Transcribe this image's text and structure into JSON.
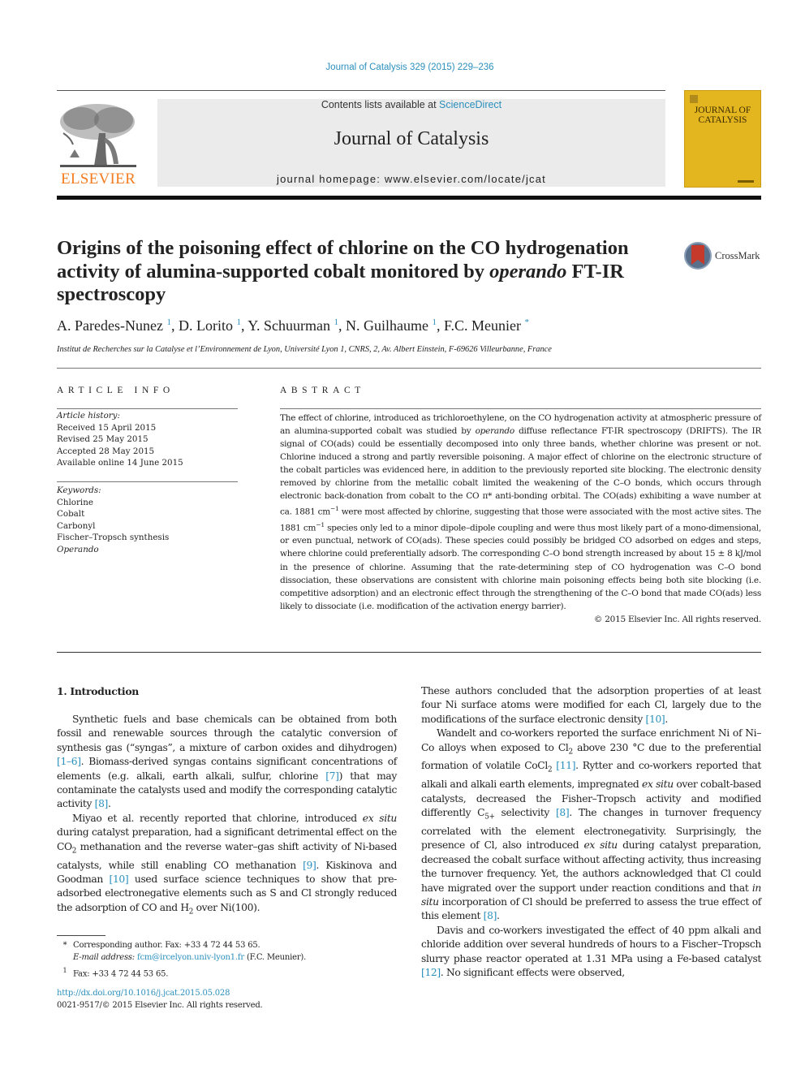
{
  "running_head": "Journal of Catalysis 329 (2015) 229–236",
  "masthead": {
    "publisher": "ELSEVIER",
    "contents_prefix": "Contents lists available at ",
    "contents_link": "ScienceDirect",
    "journal_title": "Journal of Catalysis",
    "homepage_prefix": "journal homepage: ",
    "homepage_url": "www.elsevier.com/locate/jcat",
    "cover_title_line1": "JOURNAL OF",
    "cover_title_line2": "CATALYSIS"
  },
  "colors": {
    "link": "#2a8fbd",
    "publisher_orange": "#f47c20",
    "cover_yellow": "#e3b51f",
    "masthead_gray": "#ebebeb"
  },
  "article": {
    "title_part1": "Origins of the poisoning effect of chlorine on the CO hydrogenation activity of alumina-supported cobalt monitored by ",
    "title_italic": "operando",
    "title_part2": " FT-IR spectroscopy",
    "crossmark_label": "CrossMark",
    "authors": [
      {
        "name": "A. Paredes-Nunez",
        "mark": "1"
      },
      {
        "name": "D. Lorito",
        "mark": "1"
      },
      {
        "name": "Y. Schuurman",
        "mark": "1"
      },
      {
        "name": "N. Guilhaume",
        "mark": "1"
      },
      {
        "name": "F.C. Meunier",
        "mark": "*"
      }
    ],
    "affiliation": "Institut de Recherches sur la Catalyse et l’Environnement de Lyon, Université Lyon 1, CNRS, 2, Av. Albert Einstein, F-69626 Villeurbanne, France"
  },
  "article_info": {
    "heading": "ARTICLE INFO",
    "history_label": "Article history:",
    "history": [
      "Received 15 April 2015",
      "Revised 25 May 2015",
      "Accepted 28 May 2015",
      "Available online 14 June 2015"
    ],
    "keywords_label": "Keywords:",
    "keywords": [
      "Chlorine",
      "Cobalt",
      "Carbonyl",
      "Fischer–Tropsch synthesis"
    ],
    "keyword_italic": "Operando"
  },
  "abstract": {
    "heading": "ABSTRACT",
    "s1": "The effect of chlorine, introduced as trichloroethylene, on the CO hydrogenation activity at atmospheric pressure of an alumina-supported cobalt was studied by ",
    "s1_it": "operando",
    "s2": " diffuse reflectance FT-IR spectroscopy (DRIFTS). The IR signal of CO(ads) could be essentially decomposed into only three bands, whether chlorine was present or not. Chlorine induced a strong and partly reversible poisoning. A major effect of chlorine on the electronic structure of the cobalt particles was evidenced here, in addition to the previously reported site blocking. The electronic density removed by chlorine from the metallic cobalt limited the weakening of the C–O bonds, which occurs through electronic back-donation from cobalt to the CO π* anti-bonding orbital. The CO(ads) exhibiting a wave number at ca. 1881 cm",
    "s3": " were most affected by chlorine, suggesting that those were associated with the most active sites. The 1881 cm",
    "s4": " species only led to a minor dipole–dipole coupling and were thus most likely part of a mono-dimensional, or even punctual, network of CO(ads). These species could possibly be bridged CO adsorbed on edges and steps, where chlorine could preferentially adsorb. The corresponding C–O bond strength increased by about 15 ± 8 kJ/mol in the presence of chlorine. Assuming that the rate-determining step of CO hydrogenation was C–O bond dissociation, these observations are consistent with chlorine main poisoning effects being both site blocking (i.e. competitive adsorption) and an electronic effect through the strengthening of the C–O bond that made CO(ads) less likely to dissociate (i.e. modification of the activation energy barrier).",
    "exp": "−1",
    "copyright": "© 2015 Elsevier Inc. All rights reserved."
  },
  "intro": {
    "heading": "1. Introduction",
    "p1a": "Synthetic fuels and base chemicals can be obtained from both fossil and renewable sources through the catalytic conversion of synthesis gas (“syngas”, a mixture of carbon oxides and dihydrogen) ",
    "p1_ref1": "[1–6]",
    "p1b": ". Biomass-derived syngas contains significant concentrations of elements (e.g. alkali, earth alkali, sulfur, chlorine ",
    "p1_ref2": "[7]",
    "p1c": ") that may contaminate the catalysts used and modify the corresponding catalytic activity ",
    "p1_ref3": "[8]",
    "p2a": "Miyao et al. recently reported that chlorine, introduced ",
    "p2_it": "ex situ",
    "p2b": " during catalyst preparation, had a significant detrimental effect on the CO",
    "p2c": " methanation and the reverse water–gas shift activity of Ni-based catalysts, while still enabling CO methanation ",
    "p2_ref1": "[9]",
    "p2d": ". Kiskinova and Goodman ",
    "p2_ref2": "[10]",
    "p2e": " used surface science techniques to show that pre-adsorbed electronegative elements such as S and Cl strongly reduced the adsorption of CO and H",
    "p2f": " over Ni(100).",
    "sub2": "2"
  },
  "right_col": {
    "p1a": "These authors concluded that the adsorption properties of at least four Ni surface atoms were modified for each Cl, largely due to the modifications of the surface electronic density ",
    "p1_ref": "[10]",
    "p2a": "Wandelt and co-workers reported the surface enrichment Ni of Ni–Co alloys when exposed to Cl",
    "p2b": " above 230 °C due to the preferential formation of volatile CoCl",
    "p2_ref1": "[11]",
    "p2c": ". Rytter and co-workers reported that alkali and alkali earth elements, impregnated ",
    "p2_it1": "ex situ",
    "p2d": " over cobalt-based catalysts, decreased the Fisher–Tropsch activity and modified differently C",
    "p2_sub": "5+",
    "p2e": " selectivity ",
    "p2_ref2": "[8]",
    "p2f": ". The changes in turnover frequency correlated with the element electronegativity. Surprisingly, the presence of Cl, also introduced ",
    "p2_it2": "ex situ",
    "p2g": " during catalyst preparation, decreased the cobalt surface without affecting activity, thus increasing the turnover frequency. Yet, the authors acknowledged that Cl could have migrated over the support under reaction conditions and that ",
    "p2_it3": "in situ",
    "p2h": " incorporation of Cl should be preferred to assess the true effect of this element ",
    "p2_ref3": "[8]",
    "p3a": "Davis and co-workers investigated the effect of 40 ppm alkali and chloride addition over several hundreds of hours to a Fischer–Tropsch slurry phase reactor operated at 1.31 MPa using a Fe-based catalyst ",
    "p3_ref": "[12]",
    "p3b": ". No significant effects were observed,"
  },
  "footnotes": {
    "star_mark": "*",
    "corresponding": "Corresponding author. Fax: +33 4 72 44 53 65.",
    "email_label": "E-mail address:",
    "email": "fcm@ircelyon.univ-lyon1.fr",
    "email_suffix": " (F.C. Meunier).",
    "one_mark": "1",
    "fax": "Fax: +33 4 72 44 53 65.",
    "doi": "http://dx.doi.org/10.1016/j.jcat.2015.05.028",
    "issn": "0021-9517/© 2015 Elsevier Inc. All rights reserved."
  }
}
